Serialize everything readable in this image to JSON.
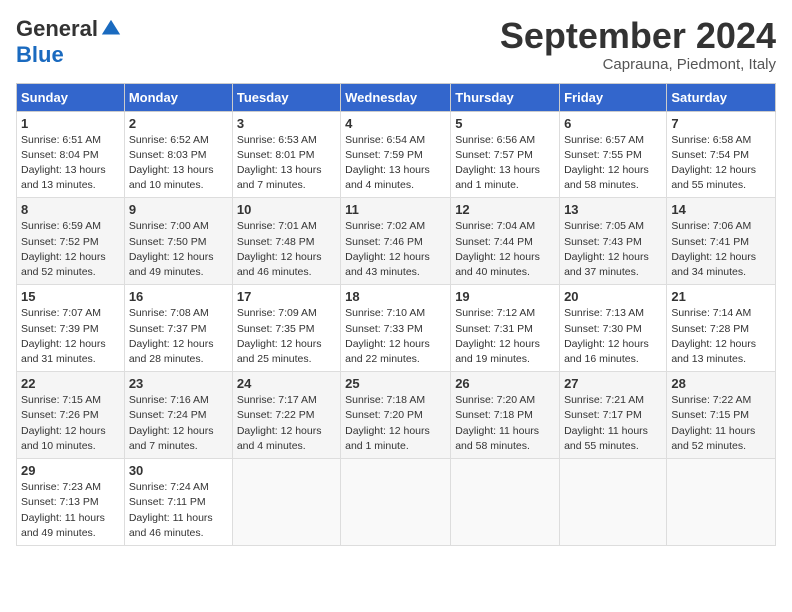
{
  "logo": {
    "general": "General",
    "blue": "Blue"
  },
  "title": "September 2024",
  "subtitle": "Caprauna, Piedmont, Italy",
  "headers": [
    "Sunday",
    "Monday",
    "Tuesday",
    "Wednesday",
    "Thursday",
    "Friday",
    "Saturday"
  ],
  "weeks": [
    [
      {
        "day": "1",
        "info": "Sunrise: 6:51 AM\nSunset: 8:04 PM\nDaylight: 13 hours\nand 13 minutes."
      },
      {
        "day": "2",
        "info": "Sunrise: 6:52 AM\nSunset: 8:03 PM\nDaylight: 13 hours\nand 10 minutes."
      },
      {
        "day": "3",
        "info": "Sunrise: 6:53 AM\nSunset: 8:01 PM\nDaylight: 13 hours\nand 7 minutes."
      },
      {
        "day": "4",
        "info": "Sunrise: 6:54 AM\nSunset: 7:59 PM\nDaylight: 13 hours\nand 4 minutes."
      },
      {
        "day": "5",
        "info": "Sunrise: 6:56 AM\nSunset: 7:57 PM\nDaylight: 13 hours\nand 1 minute."
      },
      {
        "day": "6",
        "info": "Sunrise: 6:57 AM\nSunset: 7:55 PM\nDaylight: 12 hours\nand 58 minutes."
      },
      {
        "day": "7",
        "info": "Sunrise: 6:58 AM\nSunset: 7:54 PM\nDaylight: 12 hours\nand 55 minutes."
      }
    ],
    [
      {
        "day": "8",
        "info": "Sunrise: 6:59 AM\nSunset: 7:52 PM\nDaylight: 12 hours\nand 52 minutes."
      },
      {
        "day": "9",
        "info": "Sunrise: 7:00 AM\nSunset: 7:50 PM\nDaylight: 12 hours\nand 49 minutes."
      },
      {
        "day": "10",
        "info": "Sunrise: 7:01 AM\nSunset: 7:48 PM\nDaylight: 12 hours\nand 46 minutes."
      },
      {
        "day": "11",
        "info": "Sunrise: 7:02 AM\nSunset: 7:46 PM\nDaylight: 12 hours\nand 43 minutes."
      },
      {
        "day": "12",
        "info": "Sunrise: 7:04 AM\nSunset: 7:44 PM\nDaylight: 12 hours\nand 40 minutes."
      },
      {
        "day": "13",
        "info": "Sunrise: 7:05 AM\nSunset: 7:43 PM\nDaylight: 12 hours\nand 37 minutes."
      },
      {
        "day": "14",
        "info": "Sunrise: 7:06 AM\nSunset: 7:41 PM\nDaylight: 12 hours\nand 34 minutes."
      }
    ],
    [
      {
        "day": "15",
        "info": "Sunrise: 7:07 AM\nSunset: 7:39 PM\nDaylight: 12 hours\nand 31 minutes."
      },
      {
        "day": "16",
        "info": "Sunrise: 7:08 AM\nSunset: 7:37 PM\nDaylight: 12 hours\nand 28 minutes."
      },
      {
        "day": "17",
        "info": "Sunrise: 7:09 AM\nSunset: 7:35 PM\nDaylight: 12 hours\nand 25 minutes."
      },
      {
        "day": "18",
        "info": "Sunrise: 7:10 AM\nSunset: 7:33 PM\nDaylight: 12 hours\nand 22 minutes."
      },
      {
        "day": "19",
        "info": "Sunrise: 7:12 AM\nSunset: 7:31 PM\nDaylight: 12 hours\nand 19 minutes."
      },
      {
        "day": "20",
        "info": "Sunrise: 7:13 AM\nSunset: 7:30 PM\nDaylight: 12 hours\nand 16 minutes."
      },
      {
        "day": "21",
        "info": "Sunrise: 7:14 AM\nSunset: 7:28 PM\nDaylight: 12 hours\nand 13 minutes."
      }
    ],
    [
      {
        "day": "22",
        "info": "Sunrise: 7:15 AM\nSunset: 7:26 PM\nDaylight: 12 hours\nand 10 minutes."
      },
      {
        "day": "23",
        "info": "Sunrise: 7:16 AM\nSunset: 7:24 PM\nDaylight: 12 hours\nand 7 minutes."
      },
      {
        "day": "24",
        "info": "Sunrise: 7:17 AM\nSunset: 7:22 PM\nDaylight: 12 hours\nand 4 minutes."
      },
      {
        "day": "25",
        "info": "Sunrise: 7:18 AM\nSunset: 7:20 PM\nDaylight: 12 hours\nand 1 minute."
      },
      {
        "day": "26",
        "info": "Sunrise: 7:20 AM\nSunset: 7:18 PM\nDaylight: 11 hours\nand 58 minutes."
      },
      {
        "day": "27",
        "info": "Sunrise: 7:21 AM\nSunset: 7:17 PM\nDaylight: 11 hours\nand 55 minutes."
      },
      {
        "day": "28",
        "info": "Sunrise: 7:22 AM\nSunset: 7:15 PM\nDaylight: 11 hours\nand 52 minutes."
      }
    ],
    [
      {
        "day": "29",
        "info": "Sunrise: 7:23 AM\nSunset: 7:13 PM\nDaylight: 11 hours\nand 49 minutes."
      },
      {
        "day": "30",
        "info": "Sunrise: 7:24 AM\nSunset: 7:11 PM\nDaylight: 11 hours\nand 46 minutes."
      },
      null,
      null,
      null,
      null,
      null
    ]
  ]
}
